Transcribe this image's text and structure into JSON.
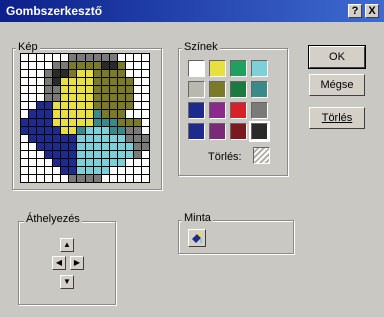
{
  "window": {
    "title": "Gombszerkesztő",
    "help_glyph": "?",
    "close_glyph": "X"
  },
  "picture": {
    "label": "Kép"
  },
  "colors": {
    "label": "Színek",
    "swatches": [
      "#ffffff",
      "#e8e040",
      "#1fa060",
      "#7ed0d8",
      "#b8b8b0",
      "#7a7a28",
      "#1a7a40",
      "#3a8a8a",
      "#1e2a8c",
      "#8a2a8a",
      "#d82028",
      "#7a7a78",
      "#1e2a8c",
      "#7a2a78",
      "#7a1a20",
      "#2a2a28"
    ],
    "erase_label": "Törlés:"
  },
  "buttons": {
    "ok": "OK",
    "cancel": "Mégse",
    "clear": "Törlés"
  },
  "move": {
    "label": "Áthelyezés",
    "up": "▲",
    "left": "◀",
    "right": "▶",
    "down": "▼"
  },
  "sample": {
    "label": "Minta"
  }
}
